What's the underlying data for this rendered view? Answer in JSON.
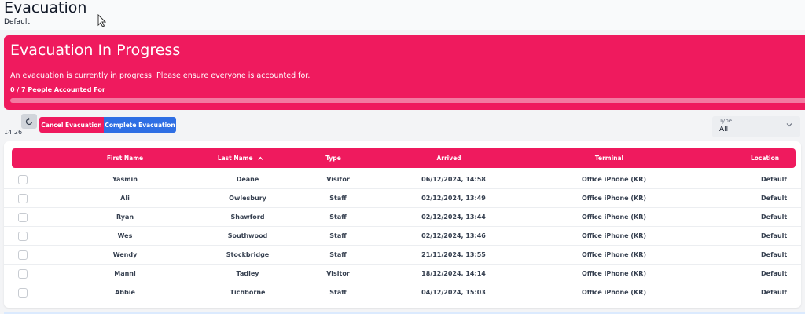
{
  "header": {
    "title": "Evacuation",
    "subtitle": "Default"
  },
  "banner": {
    "title": "Evacuation In Progress",
    "message": "An evacuation is currently in progress. Please ensure everyone is accounted for.",
    "count_text": "0 / 7 People Accounted For",
    "progress_fraction": 0,
    "color": "#ef1a5e"
  },
  "toolbar": {
    "refresh_icon": "refresh-icon",
    "time": "14:26",
    "cancel_label": "Cancel Evacuation",
    "complete_label": "Complete Evacuation",
    "cancel_color": "#ef1a5e",
    "complete_color": "#2f6fe4"
  },
  "filter": {
    "label": "Type",
    "value": "All"
  },
  "table": {
    "columns": {
      "first_name": "First Name",
      "last_name": "Last Name",
      "type": "Type",
      "arrived": "Arrived",
      "terminal": "Terminal",
      "location": "Location"
    },
    "sort": {
      "column": "last_name",
      "direction": "ascending"
    },
    "rows": [
      {
        "first": "Yasmin",
        "last": "Deane",
        "type": "Visitor",
        "arrived": "06/12/2024, 14:58",
        "terminal": "Office iPhone (KR)",
        "location": "Default"
      },
      {
        "first": "Ali",
        "last": "Owlesbury",
        "type": "Staff",
        "arrived": "02/12/2024, 13:49",
        "terminal": "Office iPhone (KR)",
        "location": "Default"
      },
      {
        "first": "Ryan",
        "last": "Shawford",
        "type": "Staff",
        "arrived": "02/12/2024, 13:44",
        "terminal": "Office iPhone (KR)",
        "location": "Default"
      },
      {
        "first": "Wes",
        "last": "Southwood",
        "type": "Staff",
        "arrived": "02/12/2024, 13:46",
        "terminal": "Office iPhone (KR)",
        "location": "Default"
      },
      {
        "first": "Wendy",
        "last": "Stockbridge",
        "type": "Staff",
        "arrived": "21/11/2024, 13:55",
        "terminal": "Office iPhone (KR)",
        "location": "Default"
      },
      {
        "first": "Manni",
        "last": "Tadley",
        "type": "Visitor",
        "arrived": "18/12/2024, 14:14",
        "terminal": "Office iPhone (KR)",
        "location": "Default"
      },
      {
        "first": "Abbie",
        "last": "Tichborne",
        "type": "Staff",
        "arrived": "04/12/2024, 15:03",
        "terminal": "Office iPhone (KR)",
        "location": "Default"
      }
    ]
  }
}
